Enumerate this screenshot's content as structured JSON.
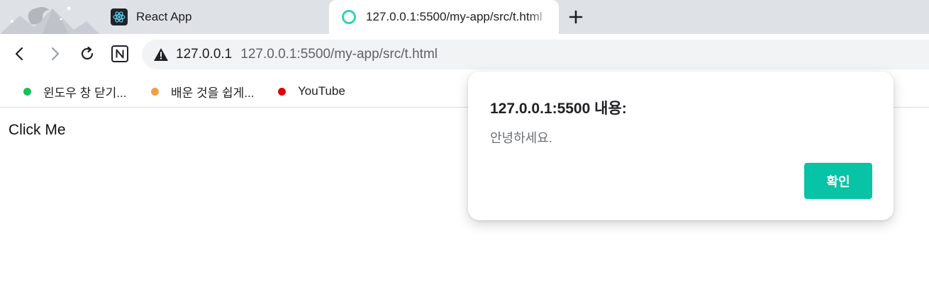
{
  "tabs": [
    {
      "title": "React App",
      "icon": "react-logo-icon",
      "active": false
    },
    {
      "title": "127.0.0.1:5500/my-app/src/t.html",
      "icon": "loading-ring-icon",
      "active": true
    }
  ],
  "toolbar": {
    "back_icon": "back-arrow-icon",
    "forward_icon": "forward-arrow-icon",
    "reload_icon": "reload-icon",
    "extension_icon": "notion-icon",
    "security_icon": "not-secure-warning-icon",
    "host": "127.0.0.1",
    "url": "127.0.0.1:5500/my-app/src/t.html"
  },
  "bookmarks": [
    {
      "label": "윈도우 창 닫기...",
      "color": "#16c05b"
    },
    {
      "label": "배운 것을 쉽게...",
      "color": "#f0a044"
    },
    {
      "label": "YouTube",
      "color": "#e00000"
    }
  ],
  "page": {
    "body_text": "Click Me"
  },
  "dialog": {
    "title": "127.0.0.1:5500 내용:",
    "message": "안녕하세요.",
    "ok_label": "확인",
    "accent_color": "#06c4a5"
  }
}
